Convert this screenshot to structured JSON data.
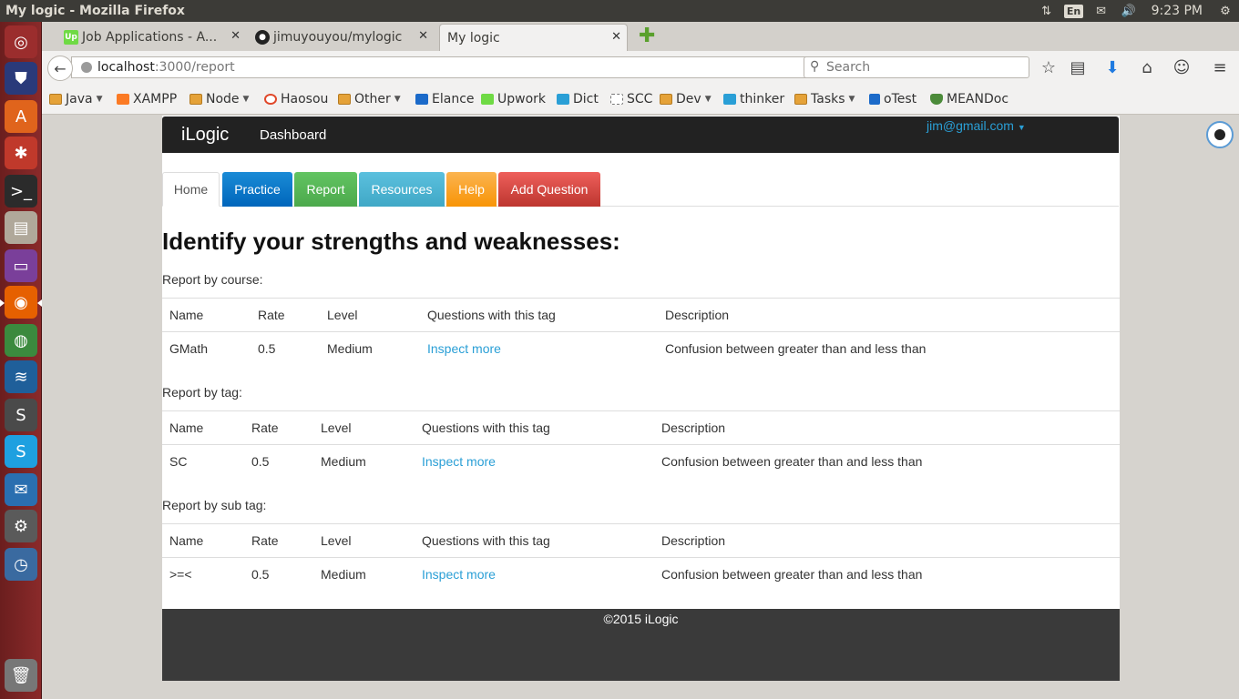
{
  "window": {
    "title": "My logic - Mozilla Firefox"
  },
  "tray": {
    "lang": "En",
    "time": "9:23 PM"
  },
  "browser": {
    "tabs": [
      {
        "label": "Job Applications - A...",
        "favicon": "Up",
        "favicon_color": "#6fda44"
      },
      {
        "label": "jimuyouyou/mylogic",
        "favicon": "github-icon",
        "favicon_color": "#222222"
      },
      {
        "label": "My logic",
        "favicon": "",
        "favicon_color": ""
      }
    ],
    "url_host": "localhost",
    "url_path": ":3000/report",
    "search_placeholder": "Search"
  },
  "bookmarks": [
    {
      "label": "Java",
      "type": "folder"
    },
    {
      "label": "XAMPP",
      "type": "link"
    },
    {
      "label": "Node",
      "type": "folder"
    },
    {
      "label": "Haosou",
      "type": "link"
    },
    {
      "label": "Other",
      "type": "folder"
    },
    {
      "label": "Elance",
      "type": "link"
    },
    {
      "label": "Upwork",
      "type": "link"
    },
    {
      "label": "Dict",
      "type": "link"
    },
    {
      "label": "SCC",
      "type": "link"
    },
    {
      "label": "Dev",
      "type": "folder"
    },
    {
      "label": "thinker",
      "type": "link"
    },
    {
      "label": "Tasks",
      "type": "folder"
    },
    {
      "label": "oTest",
      "type": "link"
    },
    {
      "label": "MEANDoc",
      "type": "link"
    }
  ],
  "app": {
    "brand": "iLogic",
    "nav_link": "Dashboard",
    "user_email": "jim@gmail.com",
    "tabs": [
      "Home",
      "Practice",
      "Report",
      "Resources",
      "Help",
      "Add Question"
    ],
    "heading": "Identify your strengths and weaknesses:",
    "columns": [
      "Name",
      "Rate",
      "Level",
      "Questions with this tag",
      "Description"
    ],
    "sections": [
      {
        "label": "Report by course:",
        "rows": [
          {
            "name": "GMath",
            "rate": "0.5",
            "level": "Medium",
            "link": "Inspect more",
            "description": "Confusion between greater than and less than"
          }
        ]
      },
      {
        "label": "Report by tag:",
        "rows": [
          {
            "name": "SC",
            "rate": "0.5",
            "level": "Medium",
            "link": "Inspect more",
            "description": "Confusion between greater than and less than"
          }
        ]
      },
      {
        "label": "Report by sub tag:",
        "rows": [
          {
            "name": ">=<",
            "rate": "0.5",
            "level": "Medium",
            "link": "Inspect more",
            "description": "Confusion between greater than and less than"
          }
        ]
      }
    ],
    "footer": "©2015 iLogic"
  }
}
